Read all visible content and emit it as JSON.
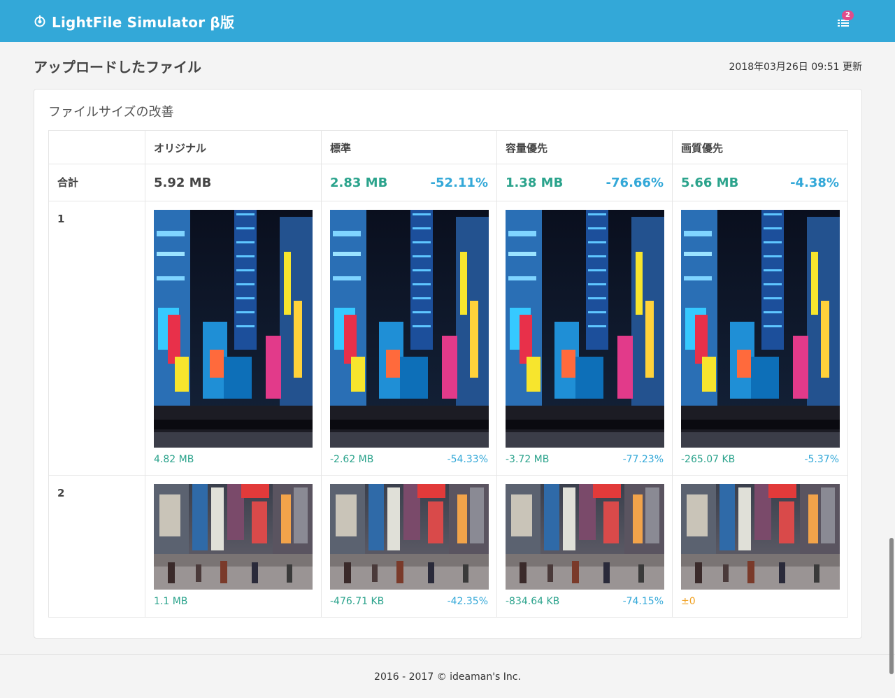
{
  "app": {
    "title": "LightFile Simulator β版",
    "notification_count": "2"
  },
  "page": {
    "title": "アップロードしたファイル",
    "updated": "2018年03月26日 09:51 更新"
  },
  "card": {
    "title": "ファイルサイズの改善"
  },
  "table": {
    "columns": [
      "",
      "オリジナル",
      "標準",
      "容量優先",
      "画質優先"
    ],
    "total": {
      "label": "合計",
      "original": "5.92 MB",
      "standard": {
        "size": "2.83 MB",
        "pct": "-52.11%"
      },
      "capacity": {
        "size": "1.38 MB",
        "pct": "-76.66%"
      },
      "quality": {
        "size": "5.66 MB",
        "pct": "-4.38%"
      }
    },
    "rows": [
      {
        "label": "1",
        "original": "4.82 MB",
        "standard": {
          "diff": "-2.62 MB",
          "pct": "-54.33%"
        },
        "capacity": {
          "diff": "-3.72 MB",
          "pct": "-77.23%"
        },
        "quality": {
          "diff": "-265.07 KB",
          "pct": "-5.37%"
        }
      },
      {
        "label": "2",
        "original": "1.1 MB",
        "standard": {
          "diff": "-476.71 KB",
          "pct": "-42.35%"
        },
        "capacity": {
          "diff": "-834.64 KB",
          "pct": "-74.15%"
        },
        "quality": {
          "diff": "±0",
          "pct": ""
        }
      }
    ]
  },
  "footer": {
    "text": "2016 - 2017 © ideaman's Inc."
  },
  "colors": {
    "navbar": "#33a8d8",
    "teal": "#2ba38c",
    "blue": "#33a8d8",
    "orange": "#f0a020",
    "badge": "#e04d8b"
  },
  "icons": {
    "brand": "power-icon",
    "notifications": "list-icon"
  }
}
